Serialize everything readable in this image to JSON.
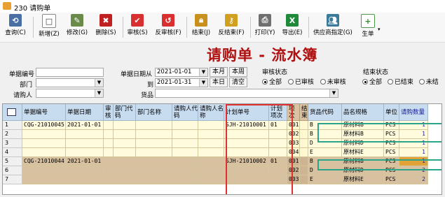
{
  "window": {
    "title": "230 请购单"
  },
  "toolbar": {
    "items": [
      {
        "label": "查询(C)",
        "icon": "query-icon"
      },
      {
        "label": "新增(Z)",
        "icon": "new-icon"
      },
      {
        "label": "修改(G)",
        "icon": "edit-icon"
      },
      {
        "label": "删除(S)",
        "icon": "delete-icon"
      },
      {
        "label": "审核(S)",
        "icon": "audit-icon"
      },
      {
        "label": "反审核(F)",
        "icon": "unaudit-icon"
      },
      {
        "label": "结束(J)",
        "icon": "lock-icon"
      },
      {
        "label": "反结束(F)",
        "icon": "key-icon"
      },
      {
        "label": "打印(Y)",
        "icon": "print-icon"
      },
      {
        "label": "导出(E)",
        "icon": "excel-icon"
      },
      {
        "label": "供应商指定(G)",
        "icon": "supplier-icon"
      },
      {
        "label": "生单",
        "icon": "generate-icon"
      }
    ]
  },
  "page_title": "请购单 - 流水簿",
  "filters": {
    "doc_no_label": "单据编号",
    "dept_label": "部门",
    "requester_label": "请购人",
    "date_from_label": "单据日期从",
    "date_to_label": "到",
    "date_from": "2021-01-01",
    "date_to": "2021-01-31",
    "goods_label": "货品",
    "btn_month": "本月",
    "btn_week": "本周",
    "btn_day": "本日",
    "btn_clear": "清空",
    "audit_status_label": "审核状态",
    "audit_options": [
      "全部",
      "已审核",
      "未审核"
    ],
    "audit_selected": "全部",
    "end_status_label": "结束状态",
    "end_options": [
      "全部",
      "已结束",
      "未结"
    ],
    "end_selected": "全部"
  },
  "grid": {
    "headers": [
      "单据编号",
      "单据日期",
      "审核",
      "部门代码",
      "部门名称",
      "请购人代码",
      "请购人名称",
      "计划单号",
      "计划项次",
      "项次",
      "结束",
      "货品代码",
      "品名规格",
      "单位",
      "请购数量"
    ],
    "rows": [
      {
        "n": "1",
        "doc": "CQG-21010045",
        "date": "2021-01-01",
        "plan": "SJH-21010001",
        "pitem": "01",
        "item": "001",
        "code": "B",
        "name": "原材料B",
        "unit": "PCS",
        "qty": "1"
      },
      {
        "n": "2",
        "doc": "",
        "date": "",
        "plan": "",
        "pitem": "",
        "item": "002",
        "code": "B",
        "name": "原材料B",
        "unit": "PCS",
        "qty": "1"
      },
      {
        "n": "3",
        "doc": "",
        "date": "",
        "plan": "",
        "pitem": "",
        "item": "003",
        "code": "D",
        "name": "原材料D",
        "unit": "PCS",
        "qty": "1"
      },
      {
        "n": "4",
        "doc": "",
        "date": "",
        "plan": "",
        "pitem": "",
        "item": "004",
        "code": "E",
        "name": "原材料E",
        "unit": "PCS",
        "qty": "1"
      },
      {
        "n": "5",
        "doc": "CQG-21010044",
        "date": "2021-01-01",
        "plan": "SJH-21010002",
        "pitem": "01",
        "item": "001",
        "code": "B",
        "name": "原材料B",
        "unit": "PCS",
        "qty": "1"
      },
      {
        "n": "6",
        "doc": "",
        "date": "",
        "plan": "",
        "pitem": "",
        "item": "002",
        "code": "D",
        "name": "原材料D",
        "unit": "PCS",
        "qty": "2"
      },
      {
        "n": "7",
        "doc": "",
        "date": "",
        "plan": "",
        "pitem": "",
        "item": "003",
        "code": "E",
        "name": "原材料E",
        "unit": "PCS",
        "qty": "2"
      }
    ]
  },
  "colors": {
    "title_red": "#b01010",
    "row_yellow": "#fffbdc",
    "row_brown": "#d8c1a0",
    "highlight_red": "#e03030",
    "highlight_teal": "#2aa58a",
    "qty_blue": "#1a1aa0"
  }
}
